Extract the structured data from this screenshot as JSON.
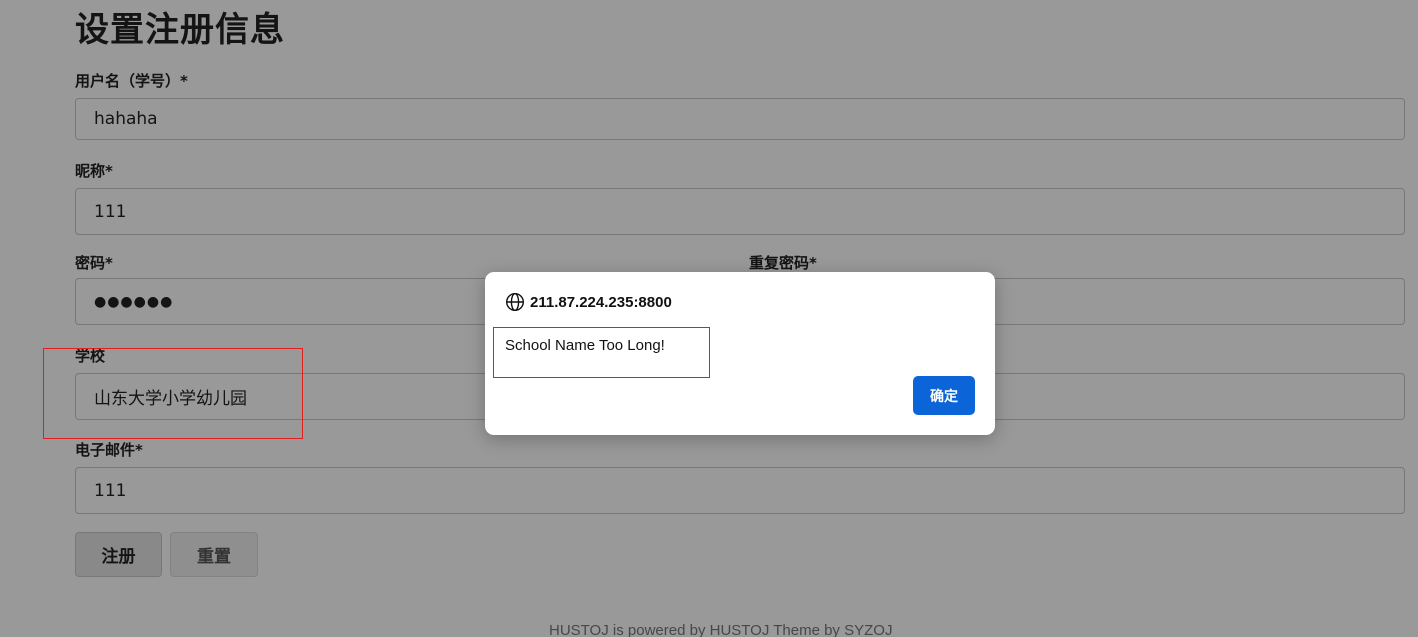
{
  "page": {
    "title": "设置注册信息",
    "fields": {
      "username": {
        "label": "用户名（学号）*",
        "value": "hahaha"
      },
      "nickname": {
        "label": "昵称*",
        "value": "111"
      },
      "password": {
        "label": "密码*",
        "value": "●●●●●●"
      },
      "repeat_password": {
        "label": "重复密码*",
        "value": ""
      },
      "school": {
        "label": "学校",
        "value": "山东大学小学幼儿园"
      },
      "email": {
        "label": "电子邮件*",
        "value": "111"
      }
    },
    "buttons": {
      "register": "注册",
      "reset": "重置"
    },
    "footer": {
      "text": "HUSTOJ is powered by HUSTOJ Theme by SYZOJ"
    }
  },
  "dialog": {
    "origin": "211.87.224.235:8800",
    "message": "School Name Too Long!",
    "ok_label": "确定",
    "globe_icon": "globe-icon"
  },
  "colors": {
    "dialog_button": "#0b65d8",
    "annotation_box": "#e02020",
    "overlay": "rgba(0,0,0,0.40)"
  }
}
